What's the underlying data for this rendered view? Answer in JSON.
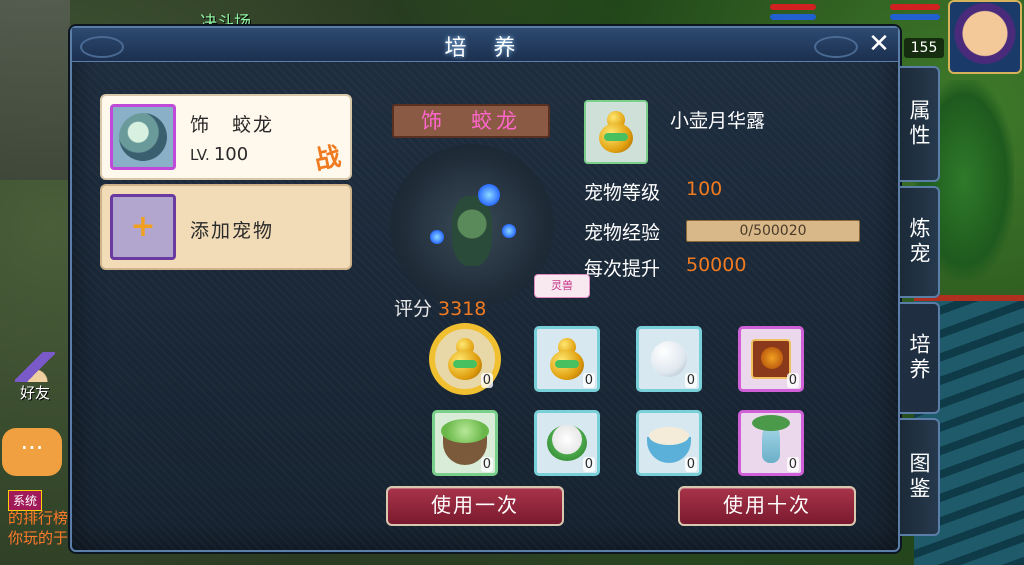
{
  "background": {
    "top_label": "决斗场",
    "player_level": "155",
    "friend_label": "好友",
    "chat_icon": "chat-bubble-icon",
    "sys_badge": "系统",
    "sys_text_line1": "的排行榜",
    "sys_text_line2": "你玩的于"
  },
  "dialog": {
    "title": "培 养",
    "close": "✕"
  },
  "pets": [
    {
      "name": "饰　蛟龙",
      "lv_label": "LV.",
      "level": "100",
      "badge": "战"
    },
    {
      "add_label": "添加宠物",
      "plus": "+"
    }
  ],
  "display": {
    "pet_title": "饰　蛟龙",
    "spirit_tag": "灵兽",
    "score_label": "评分",
    "score_value": "3318"
  },
  "item": {
    "name": "小壶月华露",
    "level_label": "宠物等级",
    "level_value": "100",
    "exp_label": "宠物经验",
    "exp_text": "0/500020",
    "exp_fraction": 0,
    "gain_label": "每次提升",
    "gain_value": "50000"
  },
  "grid": [
    {
      "icon": "large-gourd-icon",
      "count": "0",
      "frame": "green",
      "selected": true
    },
    {
      "icon": "small-gourd-icon",
      "count": "0",
      "frame": "cyan"
    },
    {
      "icon": "snowball-icon",
      "count": "0",
      "frame": "cyan"
    },
    {
      "icon": "tiger-book-icon",
      "count": "0",
      "frame": "purple"
    },
    {
      "icon": "pea-bowl-icon",
      "count": "0",
      "frame": "green"
    },
    {
      "icon": "rice-cake-icon",
      "count": "0",
      "frame": "cyan"
    },
    {
      "icon": "porridge-bowl-icon",
      "count": "0",
      "frame": "cyan"
    },
    {
      "icon": "vase-icon",
      "count": "0",
      "frame": "purple"
    }
  ],
  "buttons": {
    "use_once": "使用一次",
    "use_ten": "使用十次"
  },
  "tabs": [
    "属性",
    "炼宠",
    "培养",
    "图鉴"
  ],
  "colors": {
    "accent_orange": "#f07a20",
    "pet_title_pink": "#ff66cc",
    "button_red": "#8a2438"
  }
}
